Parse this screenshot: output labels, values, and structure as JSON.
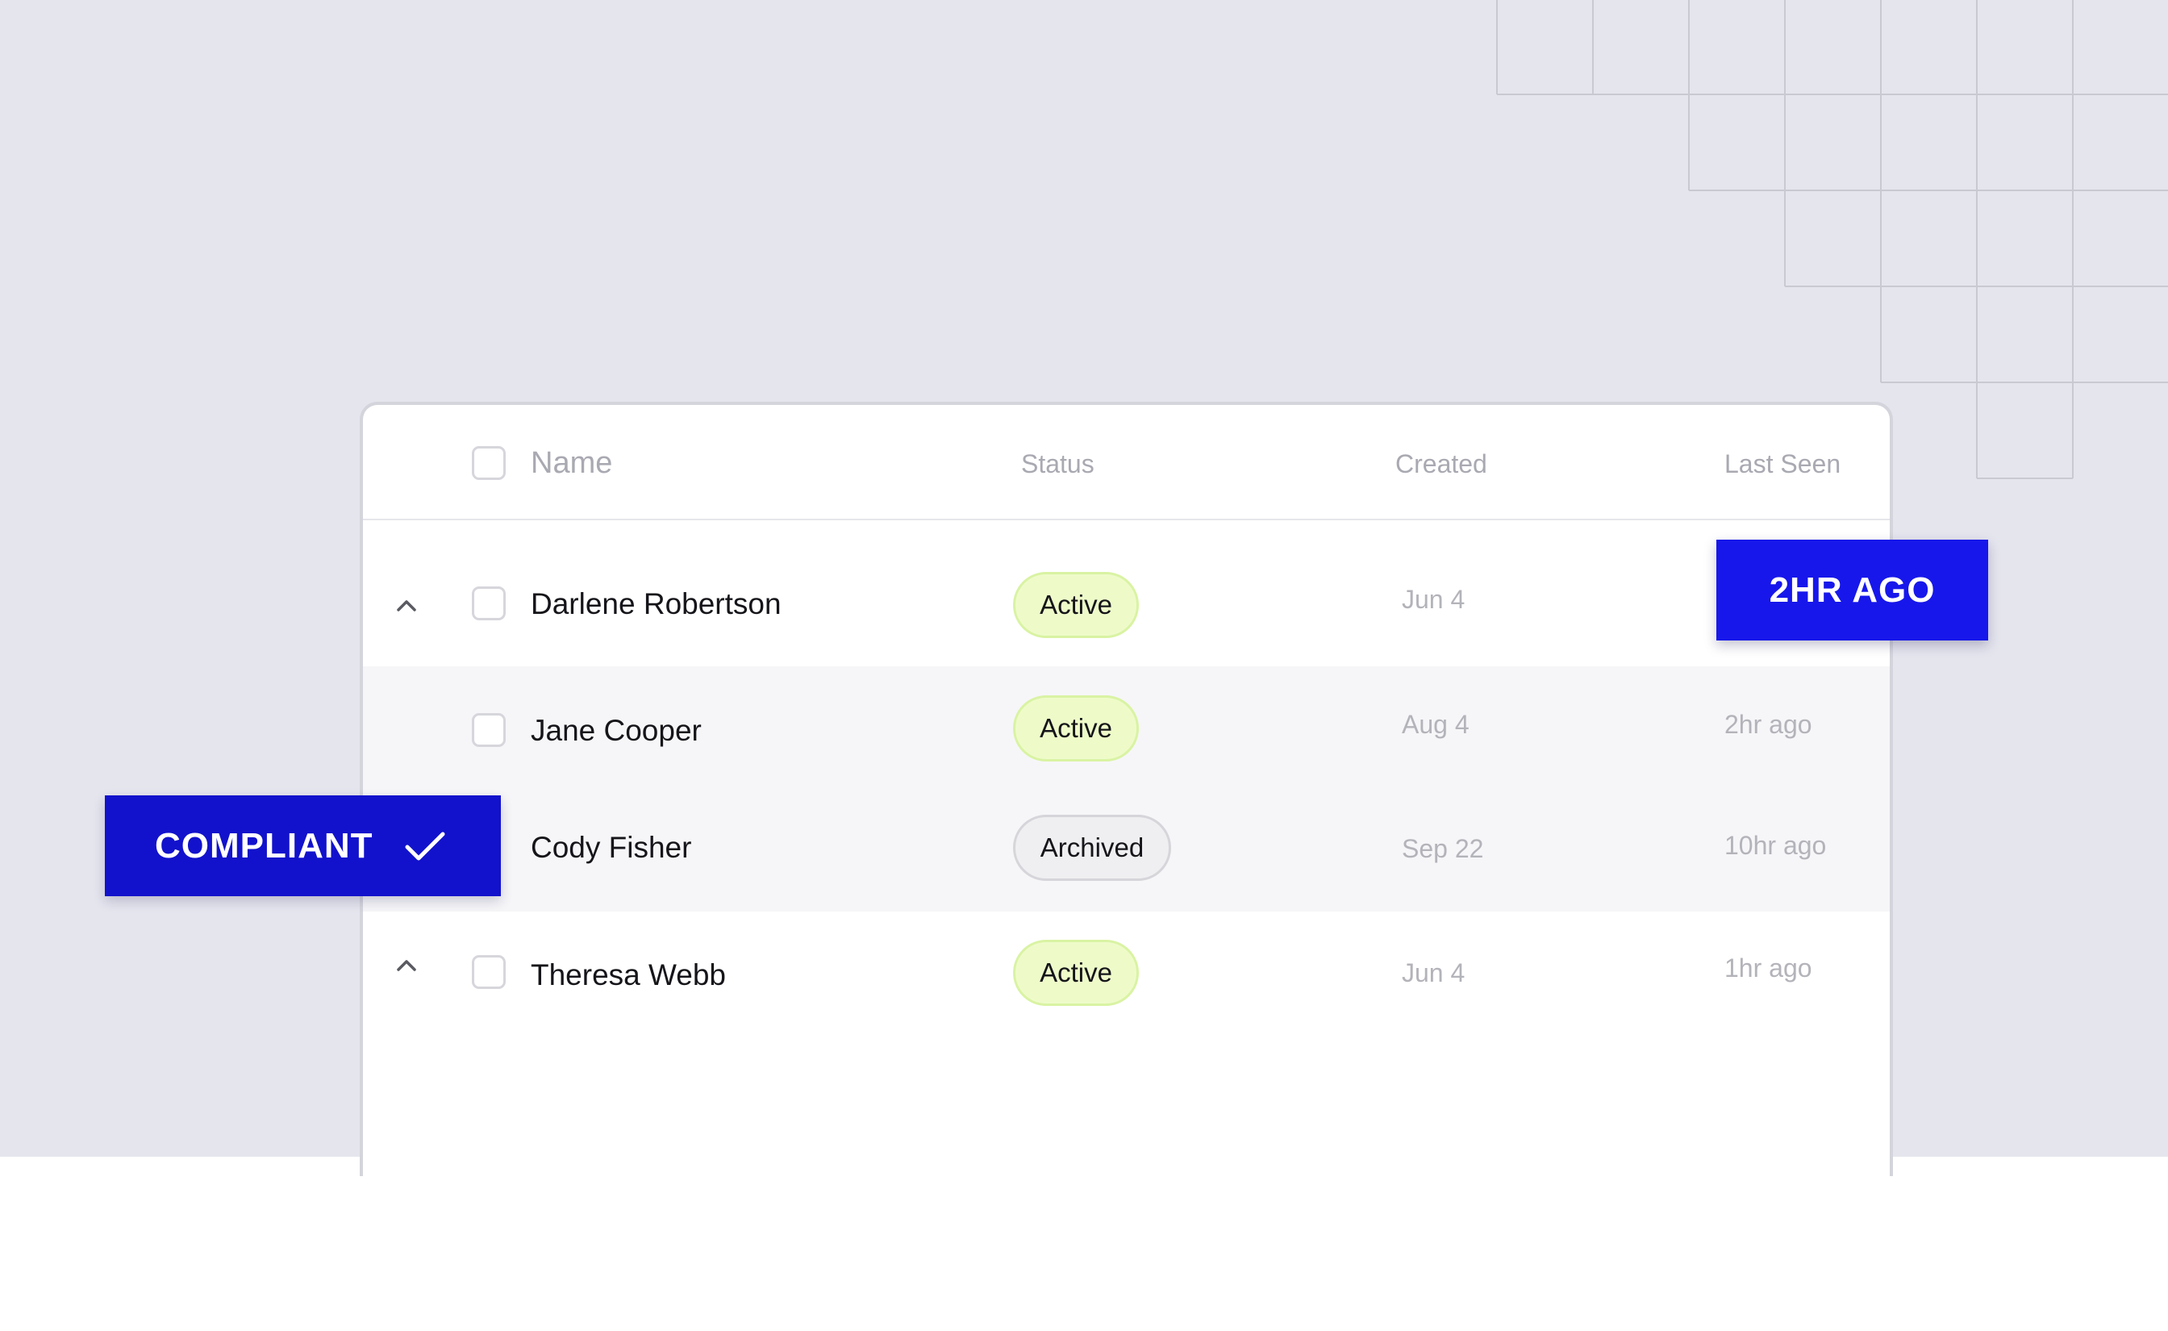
{
  "table": {
    "headers": {
      "name": "Name",
      "status": "Status",
      "created": "Created",
      "last_seen": "Last Seen"
    },
    "rows": [
      {
        "name": "Darlene Robertson",
        "status": "Active",
        "created": "Jun 4",
        "last_seen": ""
      },
      {
        "name": "Jane Cooper",
        "status": "Active",
        "created": "Aug 4",
        "last_seen": "2hr ago"
      },
      {
        "name": "Cody Fisher",
        "status": "Archived",
        "created": "Sep 22",
        "last_seen": "10hr ago"
      },
      {
        "name": "Theresa Webb",
        "status": "Active",
        "created": "Jun 4",
        "last_seen": "1hr ago"
      }
    ]
  },
  "tags": {
    "last_seen_tag": "2HR AGO",
    "compliant_tag": "COMPLIANT"
  },
  "icons": {
    "expand": "chevron-up-icon",
    "compliant": "checkmark-icon"
  },
  "colors": {
    "background": "#e5e5ee",
    "accent_blue": "#1717eb",
    "compliant_blue": "#1212cc",
    "active_badge": "#eefbc9",
    "archived_badge": "#efeff1"
  }
}
